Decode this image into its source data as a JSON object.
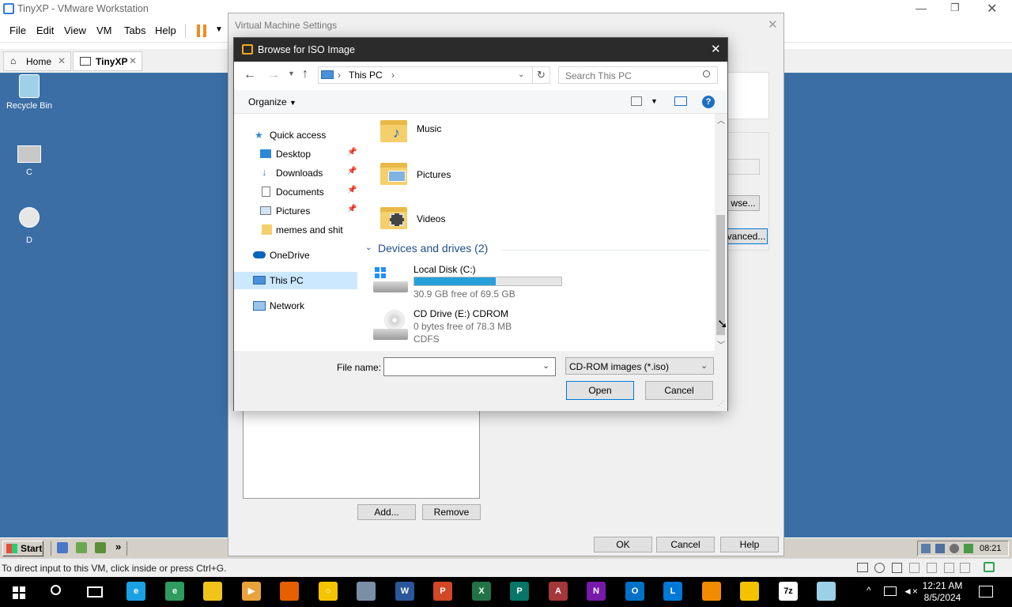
{
  "vmware": {
    "title": "TinyXP - VMware Workstation",
    "menu": [
      "File",
      "Edit",
      "View",
      "VM",
      "Tabs",
      "Help"
    ],
    "tabs": [
      {
        "label": "Home"
      },
      {
        "label": "TinyXP"
      }
    ],
    "status_text": "To direct input to this VM, click inside or press Ctrl+G."
  },
  "guest": {
    "desktop_icons": [
      {
        "label": "Recycle Bin",
        "icon": "recycle-bin-icon"
      },
      {
        "label": "C",
        "icon": "drive-shortcut-icon"
      },
      {
        "label": "D",
        "icon": "cd-drive-shortcut-icon"
      }
    ],
    "start_label": "Start",
    "quicklaunch_more": "»",
    "tray_time": "08:21"
  },
  "vm_settings": {
    "title": "Virtual Machine Settings",
    "browse_button_partial": "wse...",
    "advanced_button_partial": "vanced...",
    "add_label": "Add...",
    "remove_label": "Remove",
    "ok_label": "OK",
    "cancel_label": "Cancel",
    "help_label": "Help"
  },
  "browse_dialog": {
    "title": "Browse for ISO Image",
    "breadcrumb": "This PC",
    "search_placeholder": "Search This PC",
    "organize_label": "Organize",
    "nav": {
      "quick_access": "Quick access",
      "items": [
        {
          "label": "Desktop",
          "pinned": true
        },
        {
          "label": "Downloads",
          "pinned": true
        },
        {
          "label": "Documents",
          "pinned": true
        },
        {
          "label": "Pictures",
          "pinned": true
        },
        {
          "label": "memes and shit",
          "pinned": false
        }
      ],
      "onedrive": "OneDrive",
      "this_pc": "This PC",
      "network": "Network"
    },
    "folders": [
      {
        "name": "Music",
        "icon": "music-folder-icon"
      },
      {
        "name": "Pictures",
        "icon": "pictures-folder-icon"
      },
      {
        "name": "Videos",
        "icon": "videos-folder-icon"
      }
    ],
    "devices_header": "Devices and drives (2)",
    "drives": [
      {
        "name": "Local Disk (C:)",
        "free": "30.9 GB free of 69.5 GB",
        "used_fraction": 0.555
      },
      {
        "name": "CD Drive (E:) CDROM",
        "free": "0 bytes free of 78.3 MB",
        "fs": "CDFS"
      }
    ],
    "file_name_label": "File name:",
    "file_name_value": "",
    "filter": "CD-ROM images (*.iso)",
    "open_label": "Open",
    "cancel_label": "Cancel"
  },
  "host": {
    "clock_time": "12:21 AM",
    "clock_date": "8/5/2024",
    "taskbar_apps": [
      {
        "icon": "ie-icon",
        "color": "#1ba1e2",
        "text": "e"
      },
      {
        "icon": "edge-canary-icon",
        "color": "#2e9b5f",
        "text": "e"
      },
      {
        "icon": "file-explorer-icon",
        "color": "#f0c419",
        "text": ""
      },
      {
        "icon": "media-player-icon",
        "color": "#e8a33a",
        "text": "▶"
      },
      {
        "icon": "firefox-icon",
        "color": "#e66000",
        "text": ""
      },
      {
        "icon": "yellow-app-icon",
        "color": "#f5c400",
        "text": "○"
      },
      {
        "icon": "photos-icon",
        "color": "#7a8fa6",
        "text": ""
      },
      {
        "icon": "word-icon",
        "color": "#2b579a",
        "text": "W"
      },
      {
        "icon": "powerpoint-icon",
        "color": "#d24726",
        "text": "P"
      },
      {
        "icon": "excel-icon",
        "color": "#217346",
        "text": "X"
      },
      {
        "icon": "publisher-icon",
        "color": "#077568",
        "text": "P"
      },
      {
        "icon": "access-icon",
        "color": "#a4373a",
        "text": "A"
      },
      {
        "icon": "onenote-icon",
        "color": "#7719aa",
        "text": "N"
      },
      {
        "icon": "outlook-icon",
        "color": "#0072c6",
        "text": "O"
      },
      {
        "icon": "lync-icon",
        "color": "#0078d7",
        "text": "L"
      },
      {
        "icon": "vmware-icon",
        "color": "#f38b00",
        "text": ""
      },
      {
        "icon": "vmware-player-icon",
        "color": "#f3c300",
        "text": ""
      },
      {
        "icon": "7zip-icon",
        "color": "#ffffff",
        "text": "7z"
      },
      {
        "icon": "notepad-icon",
        "color": "#9ad1e6",
        "text": ""
      }
    ]
  }
}
